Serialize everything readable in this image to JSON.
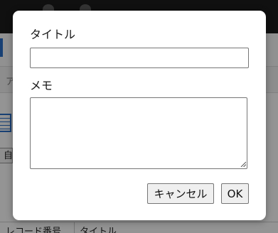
{
  "background": {
    "nav_text": "ア",
    "button_text": "自",
    "table_header": {
      "col_record_number": "レコード番号",
      "col_title": "タイトル"
    }
  },
  "dialog": {
    "title_label": "タイトル",
    "title_value": "",
    "memo_label": "メモ",
    "memo_value": "",
    "cancel_label": "キャンセル",
    "ok_label": "OK"
  }
}
